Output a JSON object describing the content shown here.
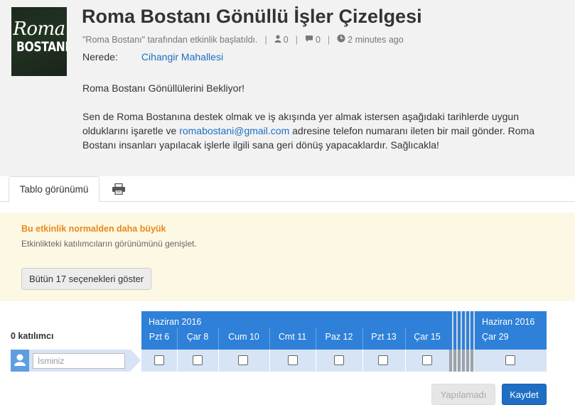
{
  "poll": {
    "logo_line1": "Roma",
    "logo_line2": "BOSTANI",
    "title": "Roma Bostanı Gönüllü İşler Çizelgesi",
    "meta": {
      "started_by": "\"Roma Bostanı\" tarafından etkinlik başlatıldı.",
      "participants_count": "0",
      "comments_count": "0",
      "time_ago": "2 minutes ago",
      "separator": "|"
    },
    "where_label": "Nerede:",
    "where_value": "Cihangir Mahallesi",
    "description": {
      "line1": "Roma Bostanı Gönüllülerini Bekliyor!",
      "p2_before": "Sen de Roma Bostanına destek olmak ve iş akışında yer almak istersen aşağıdaki tarihlerde uygun olduklarını işaretle ve ",
      "email": "romabostani@gmail.com",
      "p2_after": " adresine telefon numaranı ileten bir mail gönder. Roma Bostanı insanları yapılacak işlerle ilgili sana geri dönüş yapacaklardır. Sağlıcakla!"
    }
  },
  "tabs": {
    "table_view": "Tablo görünümü",
    "print_icon": "printer-icon"
  },
  "notice": {
    "heading": "Bu etkinlik normalden daha büyük",
    "text": "Etkinlikteki katılımcıların görünümünü genişlet.",
    "button": "Bütün 17 seçenekleri göster"
  },
  "grid": {
    "participants_label": "0 katılımcı",
    "month_left": "Haziran 2016",
    "month_right": "Haziran 2016",
    "days": [
      "Pzt 6",
      "Çar 8",
      "Cum 10",
      "Cmt 11",
      "Paz 12",
      "Pzt 13",
      "Çar 15",
      "Çar 29"
    ],
    "name_placeholder": "İsminiz",
    "user_icon": "user-icon"
  },
  "actions": {
    "cannot": "Yapılamadı",
    "save": "Kaydet"
  },
  "colors": {
    "header_blue": "#2f80d8",
    "row_blue": "#d6e4f5",
    "notice_bg": "#fdf8e4",
    "notice_heading": "#e8891d",
    "link": "#1a6fc4"
  }
}
